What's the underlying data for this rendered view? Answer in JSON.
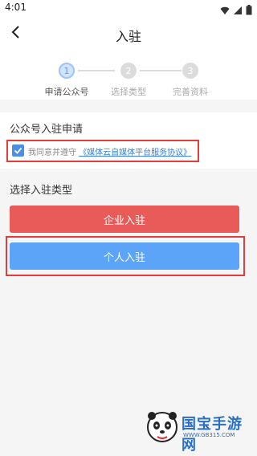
{
  "status_bar": {
    "time": "4:01",
    "icons": [
      "wifi-icon",
      "signal-icon",
      "battery-icon"
    ]
  },
  "header": {
    "title": "入驻",
    "back_icon": "chevron-left-icon"
  },
  "stepper": {
    "steps": [
      {
        "number": "1",
        "label": "申请公众号",
        "active": true
      },
      {
        "number": "2",
        "label": "选择类型",
        "active": false
      },
      {
        "number": "3",
        "label": "完善资料",
        "active": false
      }
    ]
  },
  "apply_section": {
    "title": "公众号入驻申请",
    "agreement_prefix": "我同意并遵守",
    "agreement_link": "《媒体云自媒体平台服务协议》",
    "checked": true
  },
  "type_section": {
    "title": "选择入驻类型",
    "enterprise_button": "企业入驻",
    "personal_button": "个人入驻"
  },
  "watermark": {
    "name": "国宝手游网",
    "url": "WWW.GB315.COM"
  },
  "colors": {
    "accent_blue": "#5ba4f7",
    "enterprise_red": "#e85b58",
    "highlight_red": "#e23c3c",
    "link_blue": "#3a7fd9"
  }
}
